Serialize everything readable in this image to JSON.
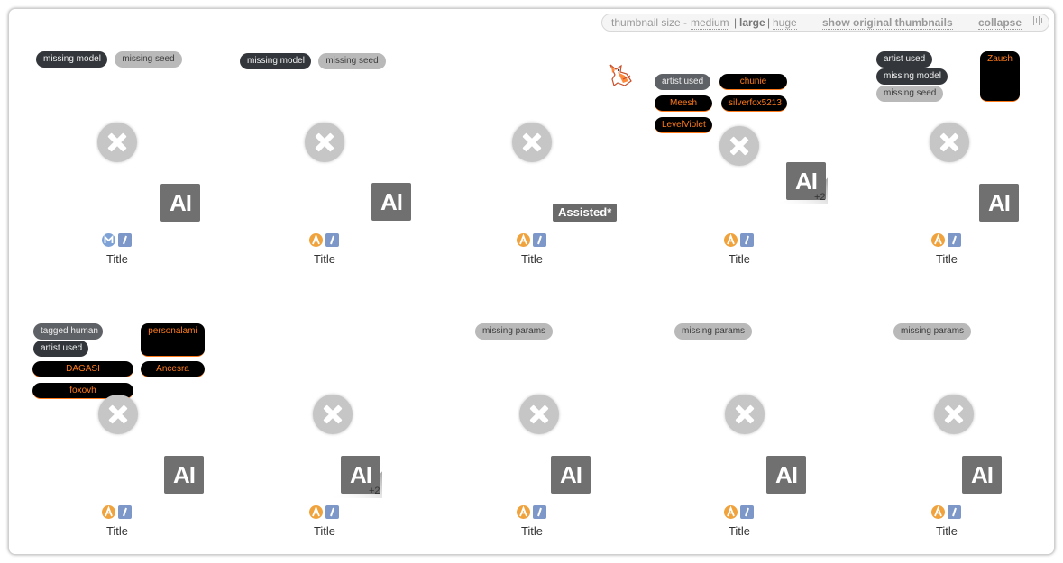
{
  "toolbar": {
    "size_label": "thumbnail size -",
    "size_medium": "medium",
    "sep1": "|",
    "size_large": "large",
    "sep2": "|",
    "size_huge": "huge",
    "show_original": "show original thumbnails",
    "collapse": "collapse"
  },
  "items": [
    {
      "tags": [
        "missing model",
        "missing seed"
      ],
      "badge_left": "M",
      "badge_right": "K",
      "title": "Title",
      "ai": "AI"
    },
    {
      "tags": [
        "missing model",
        "missing seed"
      ],
      "badge_left": "A",
      "badge_right": "K",
      "title": "Title",
      "ai": "AI"
    },
    {
      "assisted": "Assisted*",
      "badge_left": "A",
      "badge_right": "K",
      "title": "Title"
    },
    {
      "tags": [
        "artist used"
      ],
      "artists": [
        "chunie",
        "Meesh",
        "silverfox5213",
        "LevelViolet"
      ],
      "ai": "AI",
      "count": "+2",
      "badge_left": "A",
      "badge_right": "K",
      "title": "Title"
    },
    {
      "tags": [
        "artist used",
        "missing model",
        "missing seed"
      ],
      "artists": [
        "Zaush"
      ],
      "ai": "AI",
      "badge_left": "A",
      "badge_right": "K",
      "title": "Title"
    },
    {
      "tags": [
        "tagged human",
        "artist used"
      ],
      "artists": [
        "personalami",
        "DAGASI",
        "Ancesra",
        "foxovh"
      ],
      "ai": "AI",
      "badge_left": "A",
      "badge_right": "K",
      "title": "Title"
    },
    {
      "ai": "AI",
      "count": "+2",
      "badge_left": "A",
      "badge_right": "K",
      "title": "Title"
    },
    {
      "tags": [
        "missing params"
      ],
      "ai": "AI",
      "badge_left": "A",
      "badge_right": "K",
      "title": "Title"
    },
    {
      "tags": [
        "missing params"
      ],
      "ai": "AI",
      "badge_left": "A",
      "badge_right": "K",
      "title": "Title"
    },
    {
      "tags": [
        "missing params"
      ],
      "ai": "AI",
      "badge_left": "A",
      "badge_right": "K",
      "title": "Title"
    }
  ],
  "colors": {
    "artist_text": "#ff7a1a",
    "badge_model": "#7ea1d6",
    "badge_artist": "#f0a23c",
    "badge_k": "#7d98c8"
  }
}
